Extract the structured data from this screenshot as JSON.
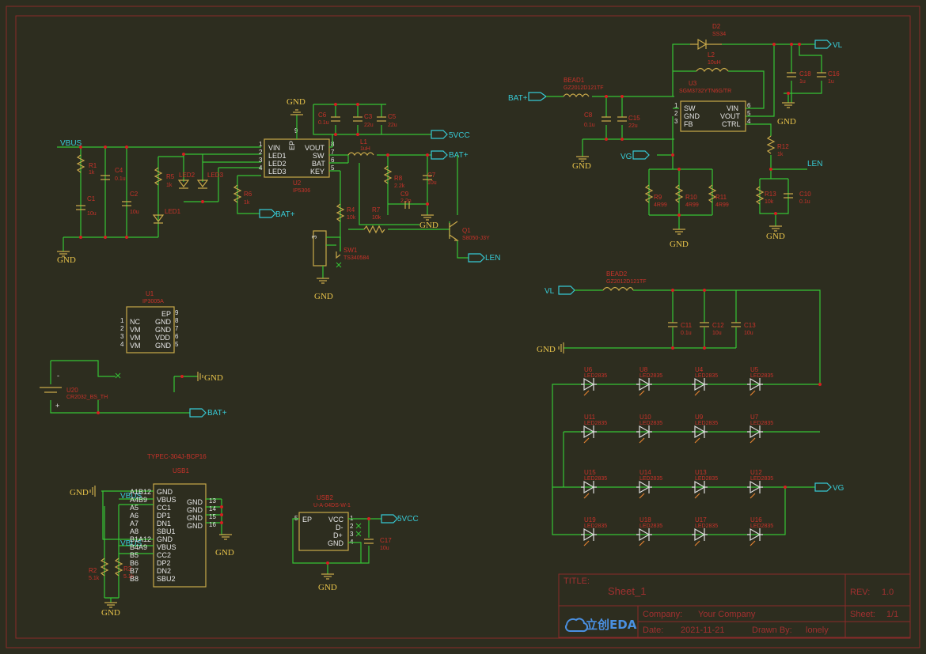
{
  "title_block": {
    "title_label": "TITLE:",
    "title": "Sheet_1",
    "rev_label": "REV:",
    "rev": "1.0",
    "company_label": "Company:",
    "company": "Your Company",
    "sheet_label": "Sheet:",
    "sheet": "1/1",
    "date_label": "Date:",
    "date": "2021-11-21",
    "drawn_label": "Drawn By:",
    "drawn": "lonely",
    "logo_text": "立创EDA"
  },
  "nets": {
    "vbus": "VBUS",
    "gnd": "GND",
    "v5": "5VCC",
    "batp": "BAT+",
    "len": "LEN",
    "vl": "VL",
    "vg": "VG"
  },
  "u2": {
    "ref": "U2",
    "value": "IP5306",
    "left_pins": [
      "VIN",
      "LED1",
      "LED2",
      "LED3"
    ],
    "left_nums": [
      "1",
      "2",
      "3",
      "4"
    ],
    "right_pins": [
      "VOUT",
      "SW",
      "BAT",
      "KEY"
    ],
    "right_nums": [
      "8",
      "7",
      "6",
      "5"
    ],
    "ep": "EP",
    "ep_num": "9"
  },
  "u1": {
    "ref": "U1",
    "value": "IP3005A",
    "left_pins": [
      "NC",
      "VM",
      "VM",
      "VM"
    ],
    "left_nums": [
      "1",
      "2",
      "3",
      "4"
    ],
    "right_pins": [
      "EP",
      "GND",
      "GND",
      "VDD",
      "GND"
    ],
    "right_nums": [
      "9",
      "8",
      "7",
      "6",
      "5"
    ]
  },
  "u3": {
    "ref": "U3",
    "value": "SGM3732YTN6G/TR",
    "left_pins": [
      "SW",
      "GND",
      "FB"
    ],
    "left_nums": [
      "1",
      "2",
      "3"
    ],
    "right_pins": [
      "VIN",
      "VOUT",
      "CTRL"
    ],
    "right_nums": [
      "6",
      "5",
      "4"
    ]
  },
  "usb1": {
    "title": "TYPEC-304J-BCP16",
    "ref": "USB1",
    "left_pins": [
      "GND",
      "VBUS",
      "CC1",
      "DP1",
      "DN1",
      "SBU1",
      "GND",
      "VBUS",
      "CC2",
      "DP2",
      "DN2",
      "SBU2"
    ],
    "left_nums": [
      "A1B12",
      "A4B9",
      "A5",
      "A6",
      "A7",
      "A8",
      "B1A12",
      "B4A9",
      "B5",
      "B6",
      "B7",
      "B8"
    ],
    "right_pins": [
      "GND",
      "GND",
      "GND",
      "GND"
    ],
    "right_nums": [
      "13",
      "14",
      "15",
      "16"
    ]
  },
  "usb2": {
    "ref": "USB2",
    "value": "U-A-04DS-W-1",
    "pins": [
      "VCC",
      "D-",
      "D+",
      "GND"
    ],
    "nums": [
      "1",
      "2",
      "3",
      "4"
    ],
    "ep": "EP",
    "ep_num": "5"
  },
  "passives": [
    {
      "ref": "R1",
      "val": "1k"
    },
    {
      "ref": "C1",
      "val": "10u"
    },
    {
      "ref": "C4",
      "val": "0.1u"
    },
    {
      "ref": "C2",
      "val": "10u"
    },
    {
      "ref": "R5",
      "val": "1k"
    },
    {
      "ref": "LED1",
      "val": ""
    },
    {
      "ref": "LED2",
      "val": ""
    },
    {
      "ref": "LED3",
      "val": ""
    },
    {
      "ref": "R6",
      "val": "1k"
    },
    {
      "ref": "C6",
      "val": "0.1u"
    },
    {
      "ref": "C3",
      "val": "22u"
    },
    {
      "ref": "C5",
      "val": "22u"
    },
    {
      "ref": "L1",
      "val": "1uH"
    },
    {
      "ref": "R8",
      "val": "2.2k"
    },
    {
      "ref": "C7",
      "val": "10u"
    },
    {
      "ref": "C9",
      "val": "2.2n"
    },
    {
      "ref": "R4",
      "val": "10k"
    },
    {
      "ref": "R7",
      "val": "10k"
    },
    {
      "ref": "Q1",
      "val": "S8050-J3Y"
    },
    {
      "ref": "SW1",
      "val": "TS340584"
    },
    {
      "ref": "BEAD1",
      "val": "GZ2012D121TF"
    },
    {
      "ref": "C8",
      "val": "0.1u"
    },
    {
      "ref": "C15",
      "val": "22u"
    },
    {
      "ref": "D2",
      "val": "SS34"
    },
    {
      "ref": "L2",
      "val": "10uH"
    },
    {
      "ref": "C18",
      "val": "1u"
    },
    {
      "ref": "C16",
      "val": "1u"
    },
    {
      "ref": "R12",
      "val": "1k"
    },
    {
      "ref": "R13",
      "val": "10k"
    },
    {
      "ref": "C10",
      "val": "0.1u"
    },
    {
      "ref": "R9",
      "val": "4R99"
    },
    {
      "ref": "R10",
      "val": "4R99"
    },
    {
      "ref": "R11",
      "val": "4R99"
    },
    {
      "ref": "BEAD2",
      "val": "GZ2012D121TF"
    },
    {
      "ref": "C11",
      "val": "0.1u"
    },
    {
      "ref": "C12",
      "val": "10u"
    },
    {
      "ref": "C13",
      "val": "10u"
    },
    {
      "ref": "R2",
      "val": "5.1k"
    },
    {
      "ref": "R3",
      "val": "5.1k"
    },
    {
      "ref": "C17",
      "val": "10u"
    },
    {
      "ref": "U20",
      "val": "CR2032_BS_TH"
    }
  ],
  "leds": [
    {
      "ref": "U6",
      "val": "LED2835"
    },
    {
      "ref": "U8",
      "val": "LED2835"
    },
    {
      "ref": "U4",
      "val": "LED2835"
    },
    {
      "ref": "U5",
      "val": "LED2835"
    },
    {
      "ref": "U11",
      "val": "LED2835"
    },
    {
      "ref": "U10",
      "val": "LED2835"
    },
    {
      "ref": "U9",
      "val": "LED2835"
    },
    {
      "ref": "U7",
      "val": "LED2835"
    },
    {
      "ref": "U15",
      "val": "LED2835"
    },
    {
      "ref": "U14",
      "val": "LED2835"
    },
    {
      "ref": "U13",
      "val": "LED2835"
    },
    {
      "ref": "U12",
      "val": "LED2835"
    },
    {
      "ref": "U19",
      "val": "LED2835"
    },
    {
      "ref": "U18",
      "val": "LED2835"
    },
    {
      "ref": "U17",
      "val": "LED2835"
    },
    {
      "ref": "U16",
      "val": "LED2835"
    }
  ],
  "colors": {
    "wire": "#35c435",
    "component": "#c9a94a",
    "reference": "#c8322a",
    "netflag": "#37c9d4",
    "junction": "#d42020",
    "frame": "#8a2a2a",
    "background": "#2d2d1f"
  }
}
